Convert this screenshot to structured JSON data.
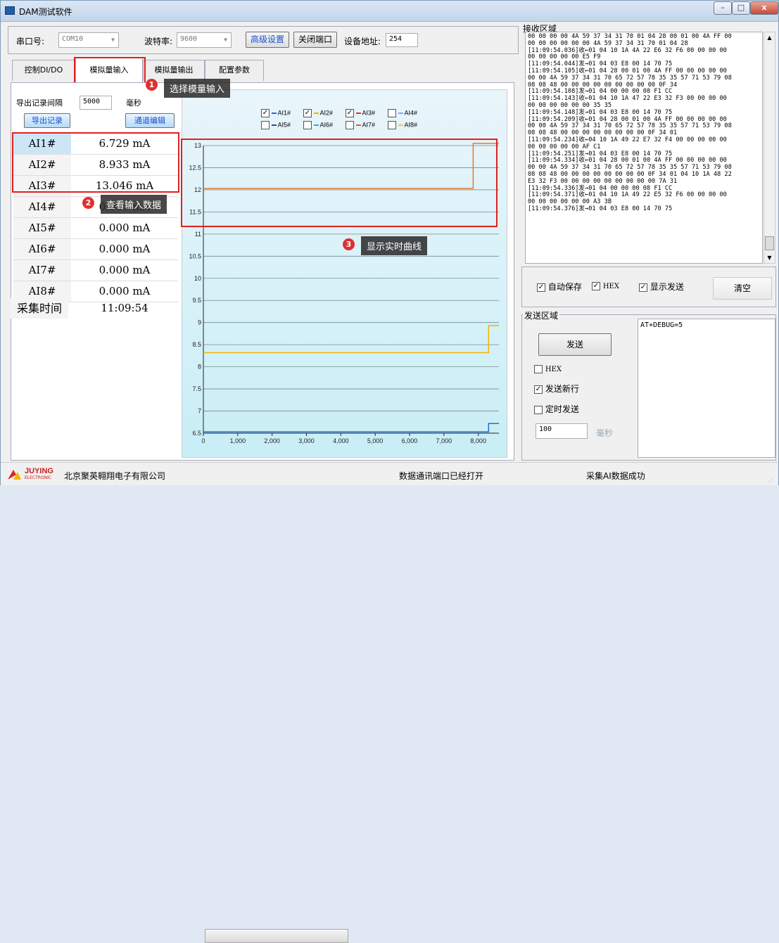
{
  "window": {
    "title": "DAM测试软件",
    "min": "–",
    "max": "□",
    "close": "x"
  },
  "serial": {
    "port_label": "串口号:",
    "port_value": "COM10",
    "baud_label": "波特率:",
    "baud_value": "9600",
    "advanced": "高级设置",
    "close_port": "关闭端口",
    "addr_label": "设备地址:",
    "addr_value": "254"
  },
  "tabs": [
    "控制DI/DO",
    "模拟量输入",
    "模拟量输出",
    "配置参数"
  ],
  "export": {
    "interval_label": "导出记录间隔",
    "interval_value": "5000",
    "unit": "毫秒",
    "export_btn": "导出记录",
    "channel_btn": "通道编辑"
  },
  "ai": [
    {
      "name": "AI1#",
      "value": "6.729 mA"
    },
    {
      "name": "AI2#",
      "value": "8.933 mA"
    },
    {
      "name": "AI3#",
      "value": "13.046 mA"
    },
    {
      "name": "AI4#",
      "value": "0.000 mA"
    },
    {
      "name": "AI5#",
      "value": "0.000 mA"
    },
    {
      "name": "AI6#",
      "value": "0.000 mA"
    },
    {
      "name": "AI7#",
      "value": "0.000 mA"
    },
    {
      "name": "AI8#",
      "value": "0.000 mA"
    }
  ],
  "collect": {
    "label": "采集时间",
    "time": "11:09:54"
  },
  "callouts": {
    "c1": "选择模量输入",
    "c2": "查看输入数据",
    "c3": "显示实时曲线",
    "n1": "1",
    "n2": "2",
    "n3": "3"
  },
  "legend": [
    {
      "name": "AI1#",
      "checked": true,
      "color": "#1e6fd9"
    },
    {
      "name": "AI2#",
      "checked": true,
      "color": "#f0b400"
    },
    {
      "name": "AI3#",
      "checked": true,
      "color": "#e03030"
    },
    {
      "name": "AI4#",
      "checked": false,
      "color": "#5fb8ee"
    },
    {
      "name": "AI5#",
      "checked": false,
      "color": "#2a4f8a"
    },
    {
      "name": "AI6#",
      "checked": false,
      "color": "#3aa0e0"
    },
    {
      "name": "AI7#",
      "checked": false,
      "color": "#e06020"
    },
    {
      "name": "AI8#",
      "checked": false,
      "color": "#f5c842"
    }
  ],
  "chart_data": {
    "type": "line",
    "y_ticks": [
      "13",
      "12.5",
      "12",
      "11.5",
      "11",
      "10.5",
      "10",
      "9.5",
      "9",
      "8.5",
      "8",
      "7.5",
      "7",
      "6.5"
    ],
    "x_ticks": [
      "0",
      "1,000",
      "2,000",
      "3,000",
      "4,000",
      "5,000",
      "6,000",
      "7,000",
      "8,000"
    ],
    "ylim": [
      6.5,
      13
    ],
    "xlim": [
      0,
      8600
    ],
    "series": [
      {
        "name": "AI1#",
        "color": "#1e6fd9",
        "points": [
          [
            0,
            6.53
          ],
          [
            8300,
            6.53
          ],
          [
            8300,
            6.72
          ],
          [
            8600,
            6.72
          ]
        ]
      },
      {
        "name": "AI2#",
        "color": "#f0b400",
        "points": [
          [
            0,
            8.32
          ],
          [
            8300,
            8.32
          ],
          [
            8300,
            8.93
          ],
          [
            8600,
            8.93
          ]
        ]
      },
      {
        "name": "AI3#",
        "color": "#e8782a",
        "points": [
          [
            0,
            12.03
          ],
          [
            7850,
            12.03
          ],
          [
            7850,
            13.05
          ],
          [
            8600,
            13.05
          ]
        ]
      }
    ]
  },
  "recv": {
    "title": "接收区域",
    "lines": [
      "00 00 00 00 4A 59 37 34 31 70 01 04 28 00 01 00 4A FF 00",
      "00 00 00 00 00 00 4A 59 37 34 31 70 01 04 28",
      "[11:09:54.036]收←01 04 10 1A 4A 22 E6 32 F6 00 00 00 00",
      "00 00 00 00 00 E5 F9",
      "[11:09:54.044]发→01 04 03 E8 00 14 70 75",
      "[11:09:54.105]收←01 04 28 00 01 00 4A FF 00 00 00 00 00",
      "00 00 4A 59 37 34 31 70 65 72 57 78 35 35 57 71 53 79 08",
      "08 08 48 00 00 00 00 00 00 00 00 00 0F 34",
      "[11:09:54.108]发→01 04 00 00 00 08 F1 CC",
      "[11:09:54.143]收←01 04 10 1A 47 22 E3 32 F3 00 00 00 00",
      "00 00 00 00 00 00 35 35",
      "[11:09:54.148]发→01 04 03 E8 00 14 70 75",
      "[11:09:54.209]收←01 04 28 00 01 00 4A FF 00 00 00 00 00",
      "00 00 4A 59 37 34 31 70 65 72 57 78 35 35 57 71 53 79 08",
      "08 08 48 00 00 00 00 00 00 00 00 0F 34 01",
      "[11:09:54.234]收←04 10 1A 49 22 E7 32 F4 00 00 00 00 00",
      "00 00 00 00 00 AF C1",
      "[11:09:54.251]发→01 04 03 E8 00 14 70 75",
      "[11:09:54.334]收←01 04 28 00 01 00 4A FF 00 00 00 00 00",
      "00 00 4A 59 37 34 31 70 65 72 57 78 35 35 57 71 53 79 08",
      "08 08 48 00 00 00 00 00 00 00 00 0F 34 01 04 10 1A 48 22",
      "E3 32 F3 00 00 00 00 00 00 00 00 00 7A 31",
      "[11:09:54.336]发→01 04 00 00 00 08 F1 CC",
      "[11:09:54.371]收←01 04 10 1A 49 22 E5 32 F6 00 00 00 00",
      "00 00 00 00 00 00 A3 3B",
      "[11:09:54.376]发→01 04 03 E8 00 14 70 75"
    ]
  },
  "recv_opts": {
    "autosave": "自动保存",
    "hex": "HEX",
    "show_send": "显示发送",
    "clear": "清空"
  },
  "send": {
    "title": "发送区域",
    "send_btn": "发送",
    "hex": "HEX",
    "newline": "发送新行",
    "timed": "定时发送",
    "interval": "100",
    "unit": "毫秒",
    "text": "AT+DEBUG=5"
  },
  "status": {
    "company": "北京聚英翱翔电子有限公司",
    "logo_main": "JUYING",
    "logo_sub": "ELECTRONIC",
    "port_msg": "数据通讯端口已经打开",
    "ai_msg": "采集AI数据成功"
  }
}
